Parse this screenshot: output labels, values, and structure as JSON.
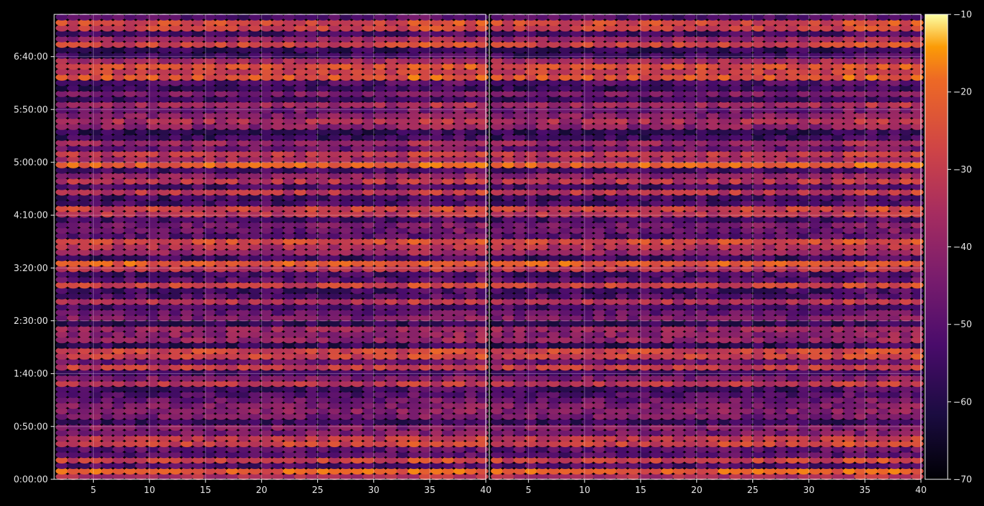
{
  "chart_data": {
    "type": "heatmap",
    "panels": [
      {
        "name": "",
        "xlim": [
          1.5,
          40
        ],
        "x_ticks": [
          5,
          10,
          15,
          20,
          25,
          30,
          35,
          40
        ]
      },
      {
        "name": "",
        "xlim": [
          1.5,
          40
        ],
        "x_ticks": [
          5,
          10,
          15,
          20,
          25,
          30,
          35,
          40
        ]
      }
    ],
    "y_axis": {
      "ylim_seconds": [
        0,
        26400
      ],
      "ticks": [
        {
          "label": "0:00:00",
          "seconds": 0
        },
        {
          "label": "0:50:00",
          "seconds": 3000
        },
        {
          "label": "1:40:00",
          "seconds": 6000
        },
        {
          "label": "2:30:00",
          "seconds": 9000
        },
        {
          "label": "3:20:00",
          "seconds": 12000
        },
        {
          "label": "4:10:00",
          "seconds": 15000
        },
        {
          "label": "5:00:00",
          "seconds": 18000
        },
        {
          "label": "5:50:00",
          "seconds": 21000
        },
        {
          "label": "6:40:00",
          "seconds": 24000
        }
      ]
    },
    "colorbar": {
      "colormap": "inferno",
      "range": [
        -70,
        -10
      ],
      "ticks": [
        "−10",
        "−20",
        "−30",
        "−40",
        "−50",
        "−60",
        "−70"
      ]
    },
    "grid": true,
    "colors": {
      "background": "#000000",
      "grid": "#ffffff",
      "frame": "#ffffff"
    }
  }
}
